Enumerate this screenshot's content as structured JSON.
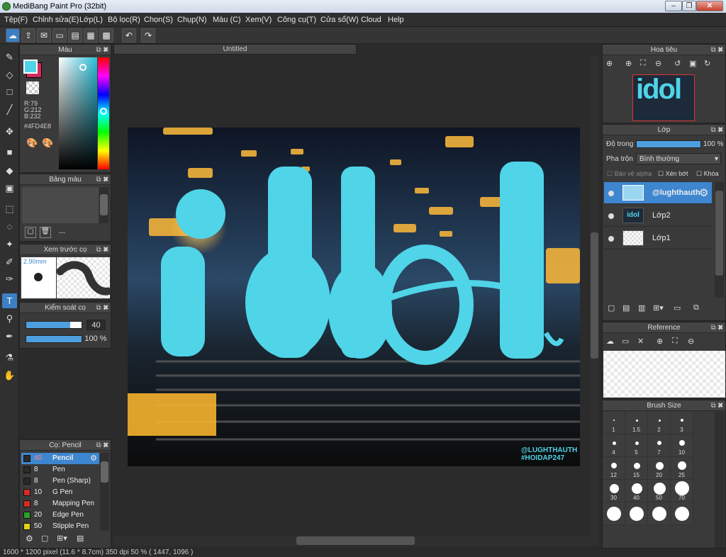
{
  "window": {
    "title": "MediBang Paint Pro (32bit)",
    "controls": [
      "–",
      "❐",
      "✕"
    ]
  },
  "menu": [
    "Tệp(F)",
    "Chỉnh sửa(E)",
    "Lớp(L)",
    "Bộ lọc(R)",
    "Chọn(S)",
    "Chụp(N)",
    "Màu (C)",
    "Xem(V)",
    "Công cụ(T)",
    "Cửa sổ(W)",
    "Cloud",
    "Help"
  ],
  "document": {
    "tab": "Untitled"
  },
  "color_panel": {
    "title": "Màu",
    "r": "R:79",
    "g": "G:212",
    "b": "B:232",
    "hex": "#4FD4E8",
    "foreground": "#4FD4E8",
    "background": "#d12a5b"
  },
  "palette_panel": {
    "title": "Bảng màu",
    "empty_label": "---"
  },
  "preview_panel": {
    "title": "Xem trước cọ",
    "size": "2.90mm"
  },
  "brush_control": {
    "title": "Kiểm soát cọ",
    "size_value": "40",
    "opacity_value": "100 %",
    "size_fraction": 0.8,
    "opacity_fraction": 1.0
  },
  "brush_list": {
    "title": "Cọ: Pencil",
    "items": [
      {
        "size": "40",
        "name": "Pencil",
        "color": "#2a2a2a"
      },
      {
        "size": "8",
        "name": "Pen",
        "color": "#2a2a2a"
      },
      {
        "size": "8",
        "name": "Pen (Sharp)",
        "color": "#2a2a2a"
      },
      {
        "size": "10",
        "name": "G Pen",
        "color": "#d42a2a"
      },
      {
        "size": "8",
        "name": "Mapping Pen",
        "color": "#d42a2a"
      },
      {
        "size": "20",
        "name": "Edge Pen",
        "color": "#2aa02a"
      },
      {
        "size": "50",
        "name": "Stipple Pen",
        "color": "#e0d020"
      }
    ]
  },
  "navigator": {
    "title": "Hoa tiêu"
  },
  "layer_panel": {
    "title": "Lớp",
    "opacity_label": "Độ trong",
    "opacity_value": "100 %",
    "opacity_fraction": 1.0,
    "blend_label": "Pha trộn",
    "blend_value": "Bình thường",
    "protect_alpha": "Bảo vệ alpha",
    "clipping": "Xén bớt",
    "lock": "Khóa",
    "layers": [
      "@lughthauth",
      "Lớp2",
      "Lớp1"
    ]
  },
  "reference": {
    "title": "Reference"
  },
  "brush_size": {
    "title": "Brush Size",
    "sizes": [
      "1",
      "1.5",
      "2",
      "3",
      "4",
      "5",
      "7",
      "10",
      "12",
      "15",
      "20",
      "25",
      "30",
      "40",
      "50",
      "70",
      "",
      "",
      "",
      ""
    ]
  },
  "artwork": {
    "main_text": "idol",
    "watermark_1": "@LUGHTHAUTH",
    "watermark_2": "#HOIDAP247",
    "text_color": "#4FD4E8"
  },
  "status": {
    "info": "1600 * 1200 pixel   (11.6 * 8.7cm)   350 dpi   50 %   ( 1447, 1096 )"
  }
}
